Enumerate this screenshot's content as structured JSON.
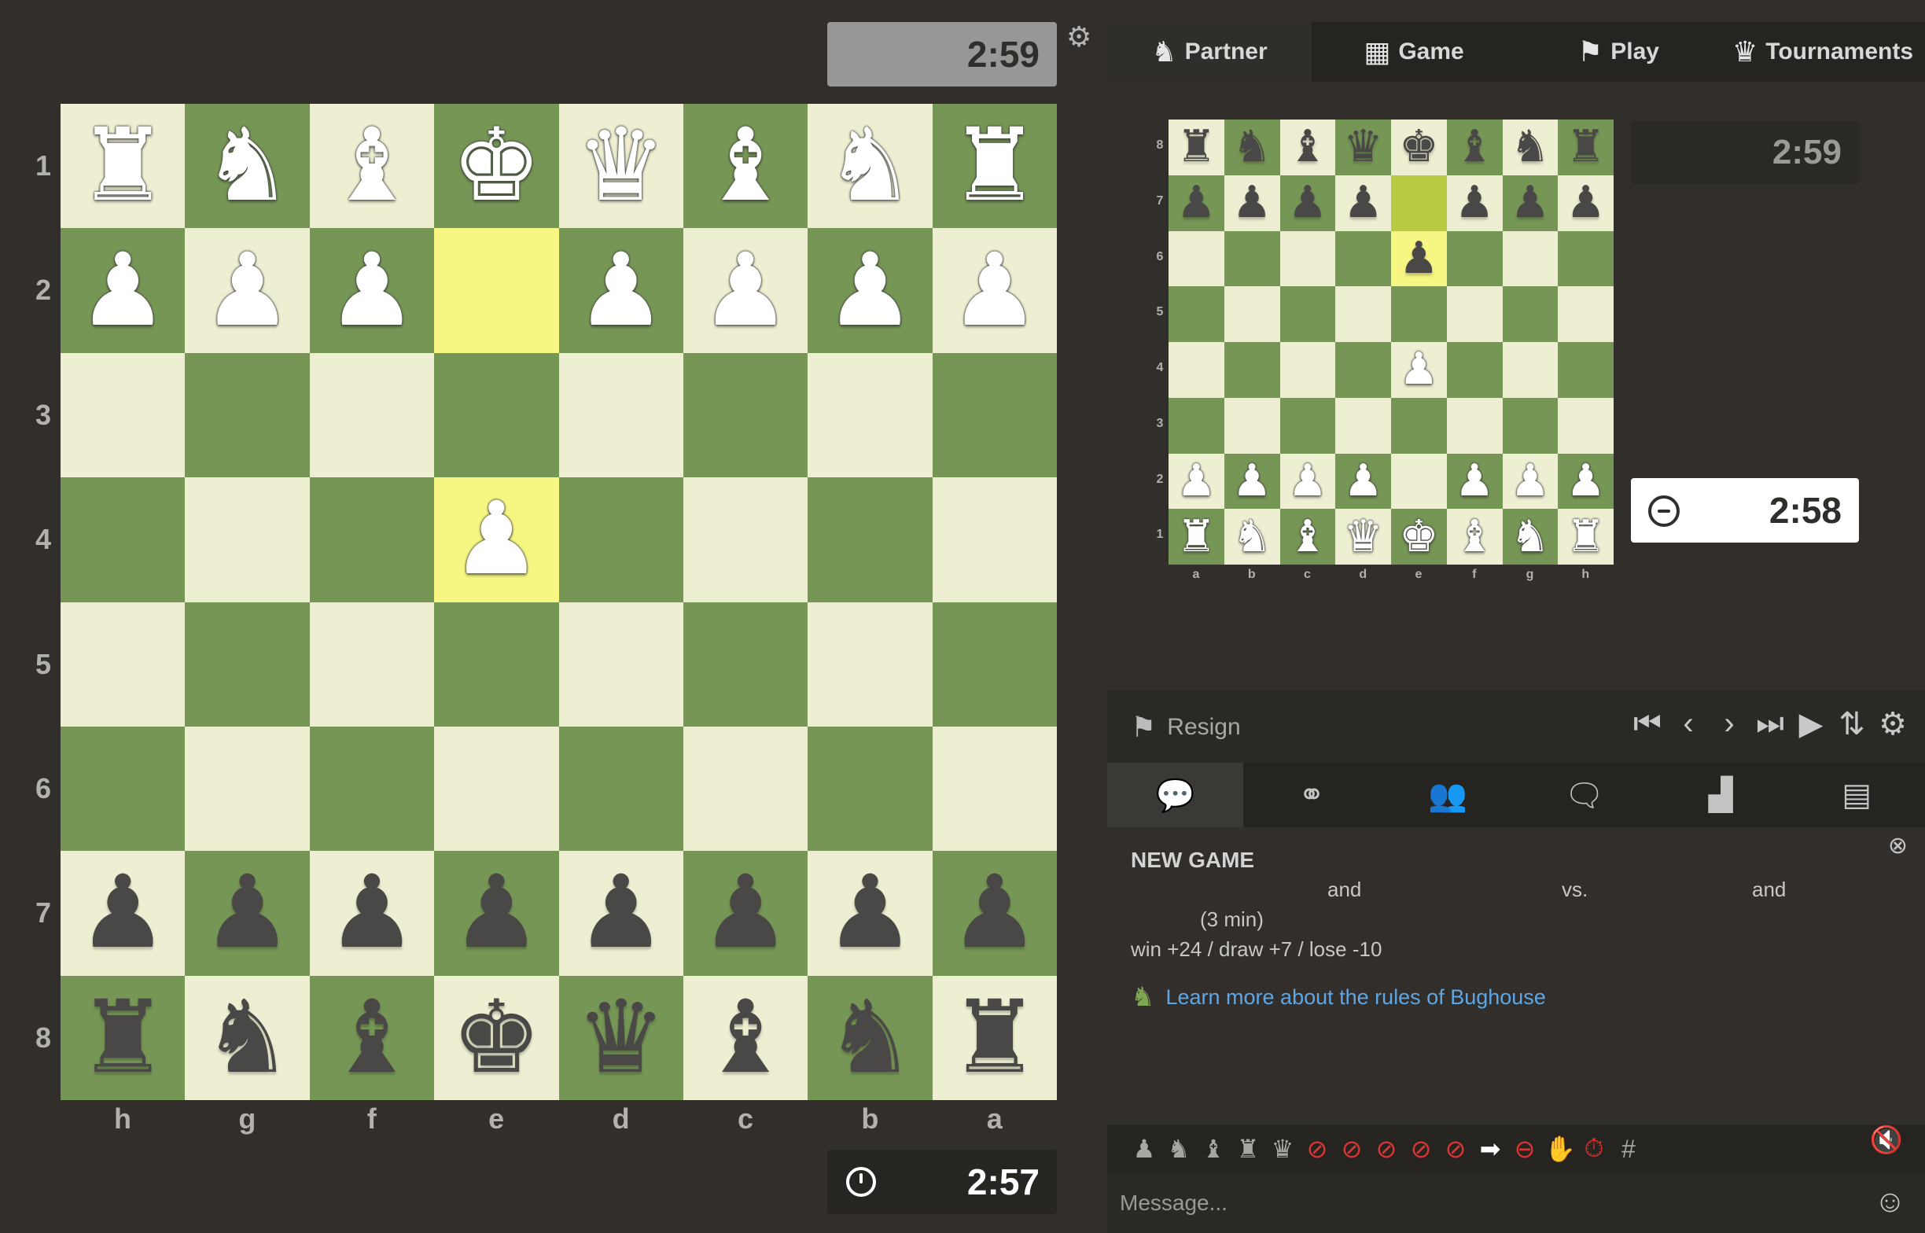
{
  "main_board": {
    "top_clock": "2:59",
    "bottom_clock": "2:57",
    "ranks": [
      "1",
      "2",
      "3",
      "4",
      "5",
      "6",
      "7",
      "8"
    ],
    "files": [
      "h",
      "g",
      "f",
      "e",
      "d",
      "c",
      "b",
      "a"
    ],
    "rows": [
      [
        "♜",
        "♞",
        "♝",
        "♚",
        "♛",
        "♝",
        "♞",
        "♜"
      ],
      [
        "♟",
        "♟",
        "♟",
        "",
        "♟",
        "♟",
        "♟",
        "♟"
      ],
      [
        "",
        "",
        "",
        "",
        "",
        "",
        "",
        ""
      ],
      [
        "",
        "",
        "",
        "♟",
        "",
        "",
        "",
        ""
      ],
      [
        "",
        "",
        "",
        "",
        "",
        "",
        "",
        ""
      ],
      [
        "",
        "",
        "",
        "",
        "",
        "",
        "",
        ""
      ],
      [
        "♟",
        "♟",
        "♟",
        "♟",
        "♟",
        "♟",
        "♟",
        "♟"
      ],
      [
        "♜",
        "♞",
        "♝",
        "♚",
        "♛",
        "♝",
        "♞",
        "♜"
      ]
    ],
    "colors": [
      [
        "w",
        "w",
        "w",
        "w",
        "w",
        "w",
        "w",
        "w"
      ],
      [
        "w",
        "w",
        "w",
        "",
        "w",
        "w",
        "w",
        "w"
      ],
      [
        "",
        "",
        "",
        "",
        "",
        "",
        "",
        ""
      ],
      [
        "",
        "",
        "",
        "w",
        "",
        "",
        "",
        ""
      ],
      [
        "",
        "",
        "",
        "",
        "",
        "",
        "",
        ""
      ],
      [
        "",
        "",
        "",
        "",
        "",
        "",
        "",
        ""
      ],
      [
        "b",
        "b",
        "b",
        "b",
        "b",
        "b",
        "b",
        "b"
      ],
      [
        "b",
        "b",
        "b",
        "b",
        "b",
        "b",
        "b",
        "b"
      ]
    ],
    "highlights": [
      "1-3",
      "3-3"
    ]
  },
  "nav": {
    "tabs": [
      {
        "label": "Partner",
        "icon": "knight-icon"
      },
      {
        "label": "Game",
        "icon": "checkerboard-icon"
      },
      {
        "label": "Play",
        "icon": "pawn-flag-icon"
      },
      {
        "label": "Tournaments",
        "icon": "trophy-icon"
      }
    ]
  },
  "partner_board": {
    "top_clock": "2:59",
    "bottom_clock": "2:58",
    "ranks": [
      "8",
      "7",
      "6",
      "5",
      "4",
      "3",
      "2",
      "1"
    ],
    "files": [
      "a",
      "b",
      "c",
      "d",
      "e",
      "f",
      "g",
      "h"
    ],
    "rows": [
      [
        "♜",
        "♞",
        "♝",
        "♛",
        "♚",
        "♝",
        "♞",
        "♜"
      ],
      [
        "♟",
        "♟",
        "♟",
        "♟",
        "",
        "♟",
        "♟",
        "♟"
      ],
      [
        "",
        "",
        "",
        "",
        "♟",
        "",
        "",
        ""
      ],
      [
        "",
        "",
        "",
        "",
        "",
        "",
        "",
        ""
      ],
      [
        "",
        "",
        "",
        "",
        "♟",
        "",
        "",
        ""
      ],
      [
        "",
        "",
        "",
        "",
        "",
        "",
        "",
        ""
      ],
      [
        "♟",
        "♟",
        "♟",
        "♟",
        "",
        "♟",
        "♟",
        "♟"
      ],
      [
        "♜",
        "♞",
        "♝",
        "♛",
        "♚",
        "♝",
        "♞",
        "♜"
      ]
    ],
    "colors": [
      [
        "b",
        "b",
        "b",
        "b",
        "b",
        "b",
        "b",
        "b"
      ],
      [
        "b",
        "b",
        "b",
        "b",
        "",
        "b",
        "b",
        "b"
      ],
      [
        "",
        "",
        "",
        "",
        "b",
        "",
        "",
        ""
      ],
      [
        "",
        "",
        "",
        "",
        "",
        "",
        "",
        ""
      ],
      [
        "",
        "",
        "",
        "",
        "w",
        "",
        "",
        ""
      ],
      [
        "",
        "",
        "",
        "",
        "",
        "",
        "",
        ""
      ],
      [
        "w",
        "w",
        "w",
        "w",
        "",
        "w",
        "w",
        "w"
      ],
      [
        "w",
        "w",
        "w",
        "w",
        "w",
        "w",
        "w",
        "w"
      ]
    ],
    "highlights": [
      "1-4",
      "2-4"
    ]
  },
  "controls": {
    "resign_label": "Resign"
  },
  "chat": {
    "title": "NEW GAME",
    "and_1": "and",
    "vs": "vs.",
    "and_2": "and",
    "time_control": "(3 min)",
    "scoring": "win +24 / draw +7 / lose -10",
    "learn_link": "Learn more about the rules of Bughouse",
    "message_placeholder": "Message..."
  }
}
